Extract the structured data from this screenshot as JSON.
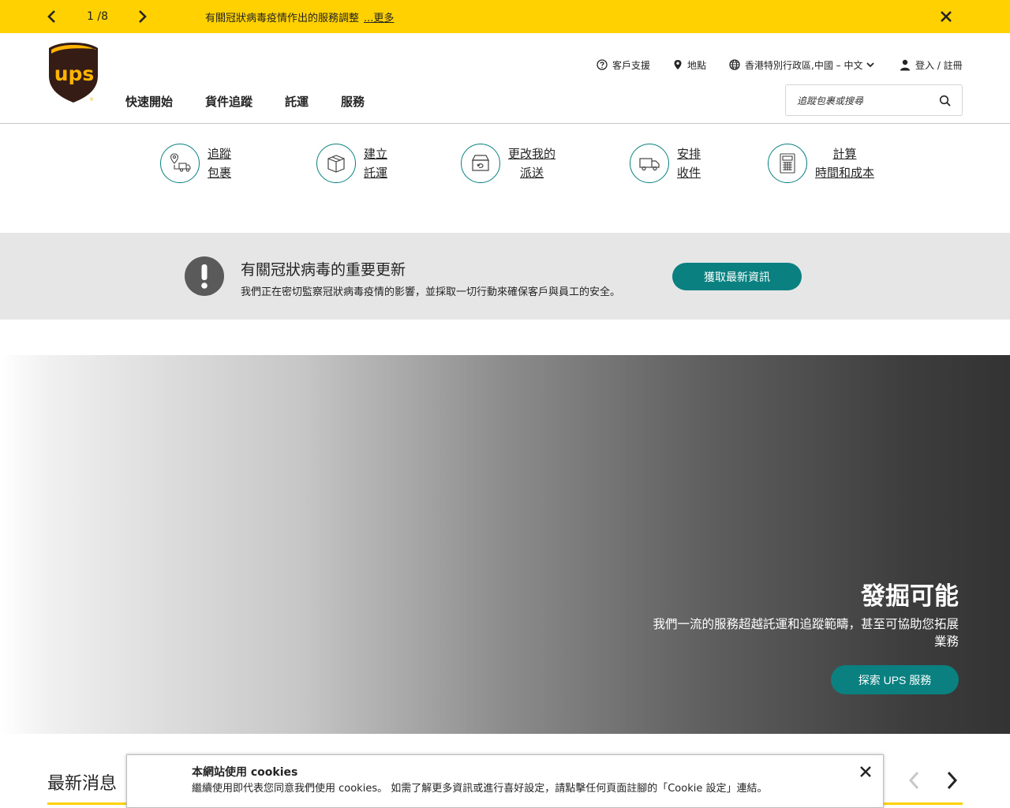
{
  "alert": {
    "counter": "1 /8",
    "message": "有關冠狀病毒疫情作出的服務調整",
    "more_link": "...更多"
  },
  "header": {
    "logo_text": "ups",
    "utility": {
      "support": "客戶支援",
      "locations": "地點",
      "region": "香港特別行政區,中國 – 中文",
      "login": "登入 / 註冊"
    },
    "nav": [
      "快速開始",
      "貨件追蹤",
      "託運",
      "服務"
    ],
    "search": {
      "placeholder": "追蹤包裹或搜尋"
    }
  },
  "quick_actions": [
    {
      "line1": "追蹤",
      "line2": "包裹",
      "icon": "track-package-icon"
    },
    {
      "line1": "建立",
      "line2": "託運",
      "icon": "box-icon"
    },
    {
      "line1": "更改我的",
      "line2": "派送",
      "icon": "change-delivery-icon"
    },
    {
      "line1": "安排",
      "line2": "收件",
      "icon": "truck-icon"
    },
    {
      "line1": "計算",
      "line2": "時間和成本",
      "icon": "calculator-icon"
    }
  ],
  "covid": {
    "title": "有關冠狀病毒的重要更新",
    "description": "我們正在密切監察冠狀病毒疫情的影響，並採取一切行動來確保客戶與員工的安全。",
    "button": "獲取最新資訊"
  },
  "hero": {
    "title": "發掘可能",
    "subtitle": "我們一流的服務超越託運和追蹤範疇，甚至可協助您拓展業務",
    "button": "探索 UPS 服務"
  },
  "news": {
    "title": "最新消息"
  },
  "cookie": {
    "title": "本網站使用 cookies",
    "text": "繼續使用即代表您同意我們使用 cookies。 如需了解更多資訊或進行喜好設定，請點擊任何頁面註腳的「Cookie 設定」連結。"
  },
  "colors": {
    "brand_yellow": "#ffd100",
    "brand_brown": "#351c15",
    "accent_teal": "#0a8080",
    "covid_band": "#e6e6e6"
  }
}
